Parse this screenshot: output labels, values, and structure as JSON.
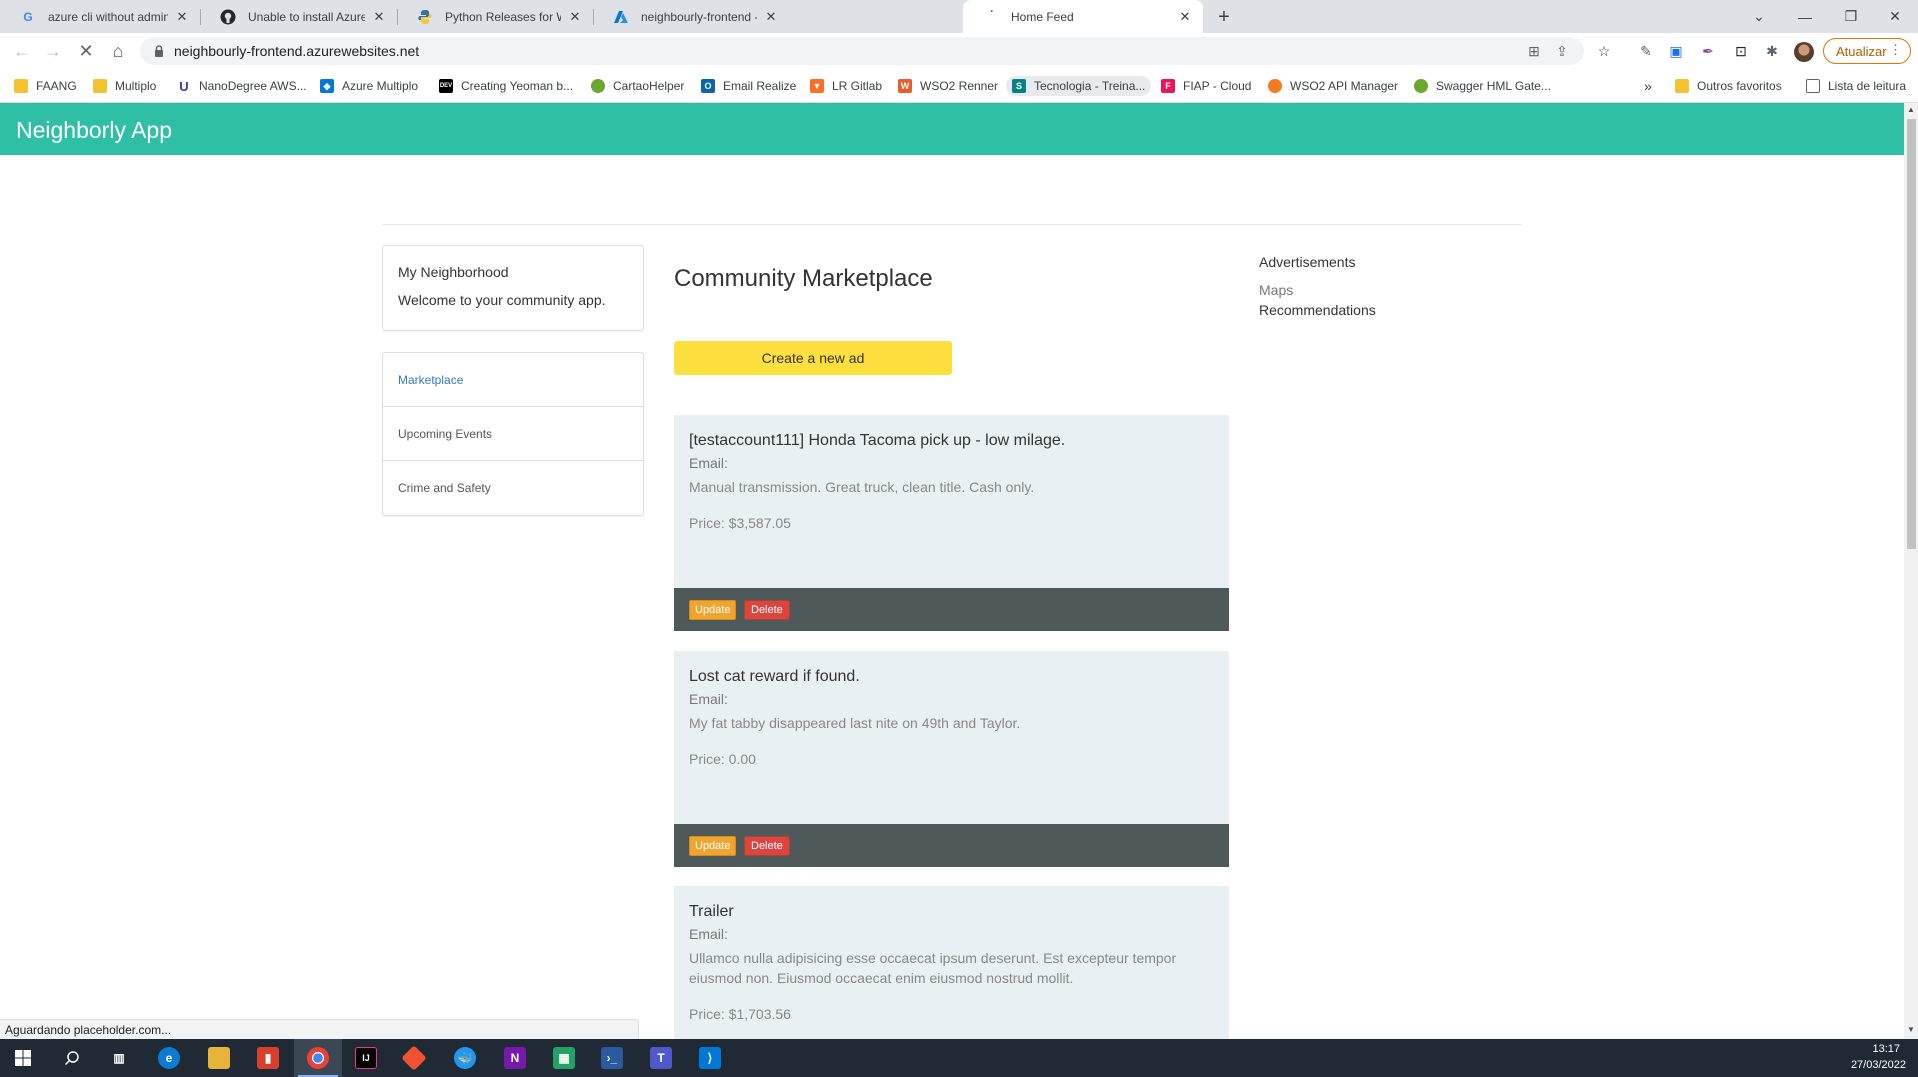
{
  "browser": {
    "tabs": [
      {
        "title": "azure cli without admin rights - F",
        "icon": "google-g-icon"
      },
      {
        "title": "Unable to install Azure CLI on Wi",
        "icon": "github-icon"
      },
      {
        "title": "Python Releases for Windows | P",
        "icon": "python-icon"
      },
      {
        "title": "neighbourly-frontend - Microsof",
        "icon": "azure-icon"
      },
      {
        "title": "Home Feed",
        "icon": "loading-icon"
      }
    ],
    "url": "neighbourly-frontend.azurewebsites.net",
    "update_button": "Atualizar",
    "bookmarks": [
      {
        "label": "FAANG",
        "icon": "folder-icon"
      },
      {
        "label": "Multiplo",
        "icon": "folder-icon"
      },
      {
        "label": "NanoDegree AWS...",
        "icon": "udacity-icon"
      },
      {
        "label": "Azure Multiplo",
        "icon": "azure-devops-icon"
      },
      {
        "label": "Creating Yeoman b...",
        "icon": "dev-icon"
      },
      {
        "label": "CartaoHelper",
        "icon": "green-circle-icon"
      },
      {
        "label": "Email Realize",
        "icon": "outlook-icon"
      },
      {
        "label": "LR Gitlab",
        "icon": "gitlab-icon"
      },
      {
        "label": "WSO2 Renner",
        "icon": "wso2-icon"
      },
      {
        "label": "Tecnologia - Treina...",
        "icon": "sharepoint-icon"
      },
      {
        "label": "FIAP - Cloud",
        "icon": "fiap-icon"
      },
      {
        "label": "WSO2 API Manager",
        "icon": "wso2-api-icon"
      },
      {
        "label": "Swagger HML Gate...",
        "icon": "swagger-icon"
      }
    ],
    "bookmarks_more": "»",
    "other_favorites": "Outros favoritos",
    "reading_list": "Lista de leitura",
    "status_text": "Aguardando placeholder.com..."
  },
  "app": {
    "title": "Neighborly App",
    "neighborhood": {
      "title": "My Neighborhood",
      "welcome": "Welcome to your community app."
    },
    "nav": [
      {
        "label": "Marketplace",
        "active": true
      },
      {
        "label": "Upcoming Events",
        "active": false
      },
      {
        "label": "Crime and Safety",
        "active": false
      }
    ],
    "marketplace": {
      "heading": "Community Marketplace",
      "create_button": "Create a new ad",
      "ads": [
        {
          "title": "[testaccount111] Honda Tacoma pick up - low milage.",
          "email": "Email:",
          "description": "Manual transmission. Great truck, clean title. Cash only.",
          "price": "Price: $3,587.05",
          "update": "Update",
          "delete": "Delete"
        },
        {
          "title": "Lost cat reward if found.",
          "email": "Email:",
          "description": "My fat tabby disappeared last nite on 49th and Taylor.",
          "price": "Price: 0.00",
          "update": "Update",
          "delete": "Delete"
        },
        {
          "title": "Trailer",
          "email": "Email:",
          "description": "Ullamco nulla adipisicing esse occaecat ipsum deserunt. Est excepteur tempor eiusmod non. Eiusmod occaecat enim eiusmod nostrud mollit.",
          "price": "Price: $1,703.56",
          "update": "Update",
          "delete": "Delete"
        }
      ]
    },
    "sidebar_ads": {
      "title": "Advertisements",
      "maps": "Maps",
      "recommendations": "Recommendations"
    }
  },
  "taskbar": {
    "time": "13:17",
    "date": "27/03/2022"
  },
  "colors": {
    "header": "#2ebfa5",
    "create_button": "#fddf3d",
    "card_bg": "#e9f0f4",
    "card_footer": "#4e5a5a",
    "update_button": "#f0a531",
    "delete_button": "#d9463f",
    "nav_active": "#337ab7"
  }
}
